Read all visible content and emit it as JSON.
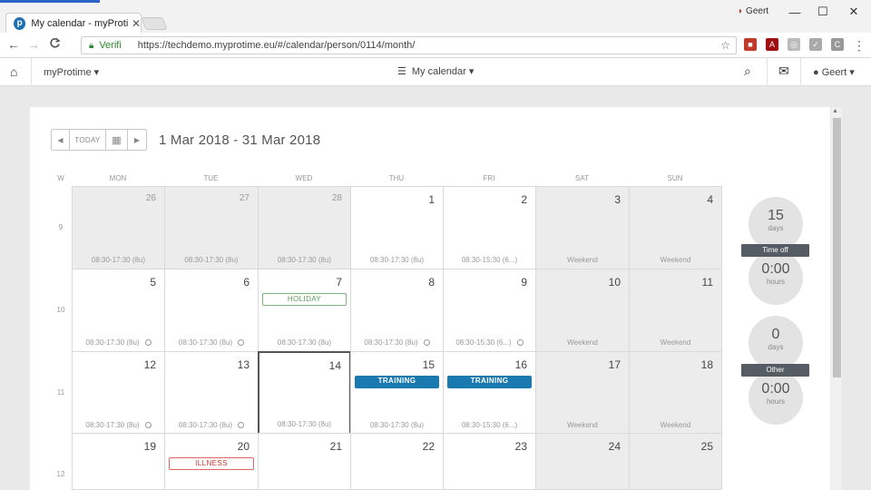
{
  "browser": {
    "tab_title": "My calendar - myProtime",
    "favicon_letter": "p",
    "tab_close": "✕",
    "window_user": "Geert",
    "window_user_icon": "user-badge-icon",
    "win_minimize": "—",
    "win_maximize": "☐",
    "win_close": "✕",
    "back": "←",
    "forward": "→",
    "reload": "C",
    "secure_label": "Verifi",
    "url": "https://techdemo.myprotime.eu/#/calendar/person/0114/month/",
    "star": "☆",
    "menu": "⋮"
  },
  "appbar": {
    "home_icon": "⌂",
    "brand": "myProtime",
    "brand_caret": "▾",
    "center_icon": "☰",
    "center_label": "My calendar",
    "center_caret": "▾",
    "search_icon": "⌕",
    "mail_icon": "✉",
    "user_icon": "●",
    "user": "Geert",
    "user_caret": "▾"
  },
  "toolbar": {
    "prev": "◀",
    "today": "TODAY",
    "picker": "▦",
    "next": "▶",
    "range": "1 Mar 2018 - 31 Mar 2018"
  },
  "calendar": {
    "week_header": "W",
    "days": [
      "MON",
      "TUE",
      "WED",
      "THU",
      "FRI",
      "SAT",
      "SUN"
    ],
    "weeks": [
      {
        "no": "9",
        "cells": [
          {
            "day": "26",
            "outside": true,
            "sched": "08:30-17:30 (8u)"
          },
          {
            "day": "27",
            "outside": true,
            "sched": "08:30-17:30 (8u)"
          },
          {
            "day": "28",
            "outside": true,
            "sched": "08:30-17:30 (8u)"
          },
          {
            "day": "1",
            "sched": "08:30-17:30 (8u)"
          },
          {
            "day": "2",
            "sched": "08:30-15:30 (6...)"
          },
          {
            "day": "3",
            "weekend": true,
            "sched": "Weekend"
          },
          {
            "day": "4",
            "weekend": true,
            "sched": "Weekend"
          }
        ]
      },
      {
        "no": "10",
        "cells": [
          {
            "day": "5",
            "sched": "08:30-17:30 (8u)",
            "clock": true
          },
          {
            "day": "6",
            "sched": "08:30-17:30 (8u)",
            "clock": true
          },
          {
            "day": "7",
            "sched": "08:30-17:30 (8u)",
            "tag": "HOLIDAY",
            "tagType": "holiday"
          },
          {
            "day": "8",
            "sched": "08:30-17:30 (8u)",
            "clock": true
          },
          {
            "day": "9",
            "sched": "08:30-15:30 (6...)",
            "clock": true
          },
          {
            "day": "10",
            "weekend": true,
            "sched": "Weekend"
          },
          {
            "day": "11",
            "weekend": true,
            "sched": "Weekend"
          }
        ]
      },
      {
        "no": "11",
        "cells": [
          {
            "day": "12",
            "sched": "08:30-17:30 (8u)",
            "clock": true
          },
          {
            "day": "13",
            "sched": "08:30-17:30 (8u)",
            "clock": true
          },
          {
            "day": "14",
            "sched": "08:30-17:30 (8u)",
            "today": true
          },
          {
            "day": "15",
            "sched": "08:30-17:30 (8u)",
            "tag": "TRAINING",
            "tagType": "training"
          },
          {
            "day": "16",
            "sched": "08:30-15:30 (6...)",
            "tag": "TRAINING",
            "tagType": "training"
          },
          {
            "day": "17",
            "weekend": true,
            "sched": "Weekend"
          },
          {
            "day": "18",
            "weekend": true,
            "sched": "Weekend"
          }
        ]
      },
      {
        "no": "12",
        "cells": [
          {
            "day": "19",
            "sched": ""
          },
          {
            "day": "20",
            "sched": "",
            "tag": "ILLNESS",
            "tagType": "illness"
          },
          {
            "day": "21",
            "sched": ""
          },
          {
            "day": "22",
            "sched": ""
          },
          {
            "day": "23",
            "sched": ""
          },
          {
            "day": "24",
            "weekend": true,
            "sched": ""
          },
          {
            "day": "25",
            "weekend": true,
            "sched": ""
          }
        ]
      }
    ]
  },
  "counters": {
    "timeoff": {
      "label": "Time off",
      "days_value": "15",
      "days_unit": "days",
      "hours_value": "0:00",
      "hours_unit": "hours"
    },
    "other": {
      "label": "Other",
      "days_value": "0",
      "days_unit": "days",
      "hours_value": "0:00",
      "hours_unit": "hours"
    }
  }
}
